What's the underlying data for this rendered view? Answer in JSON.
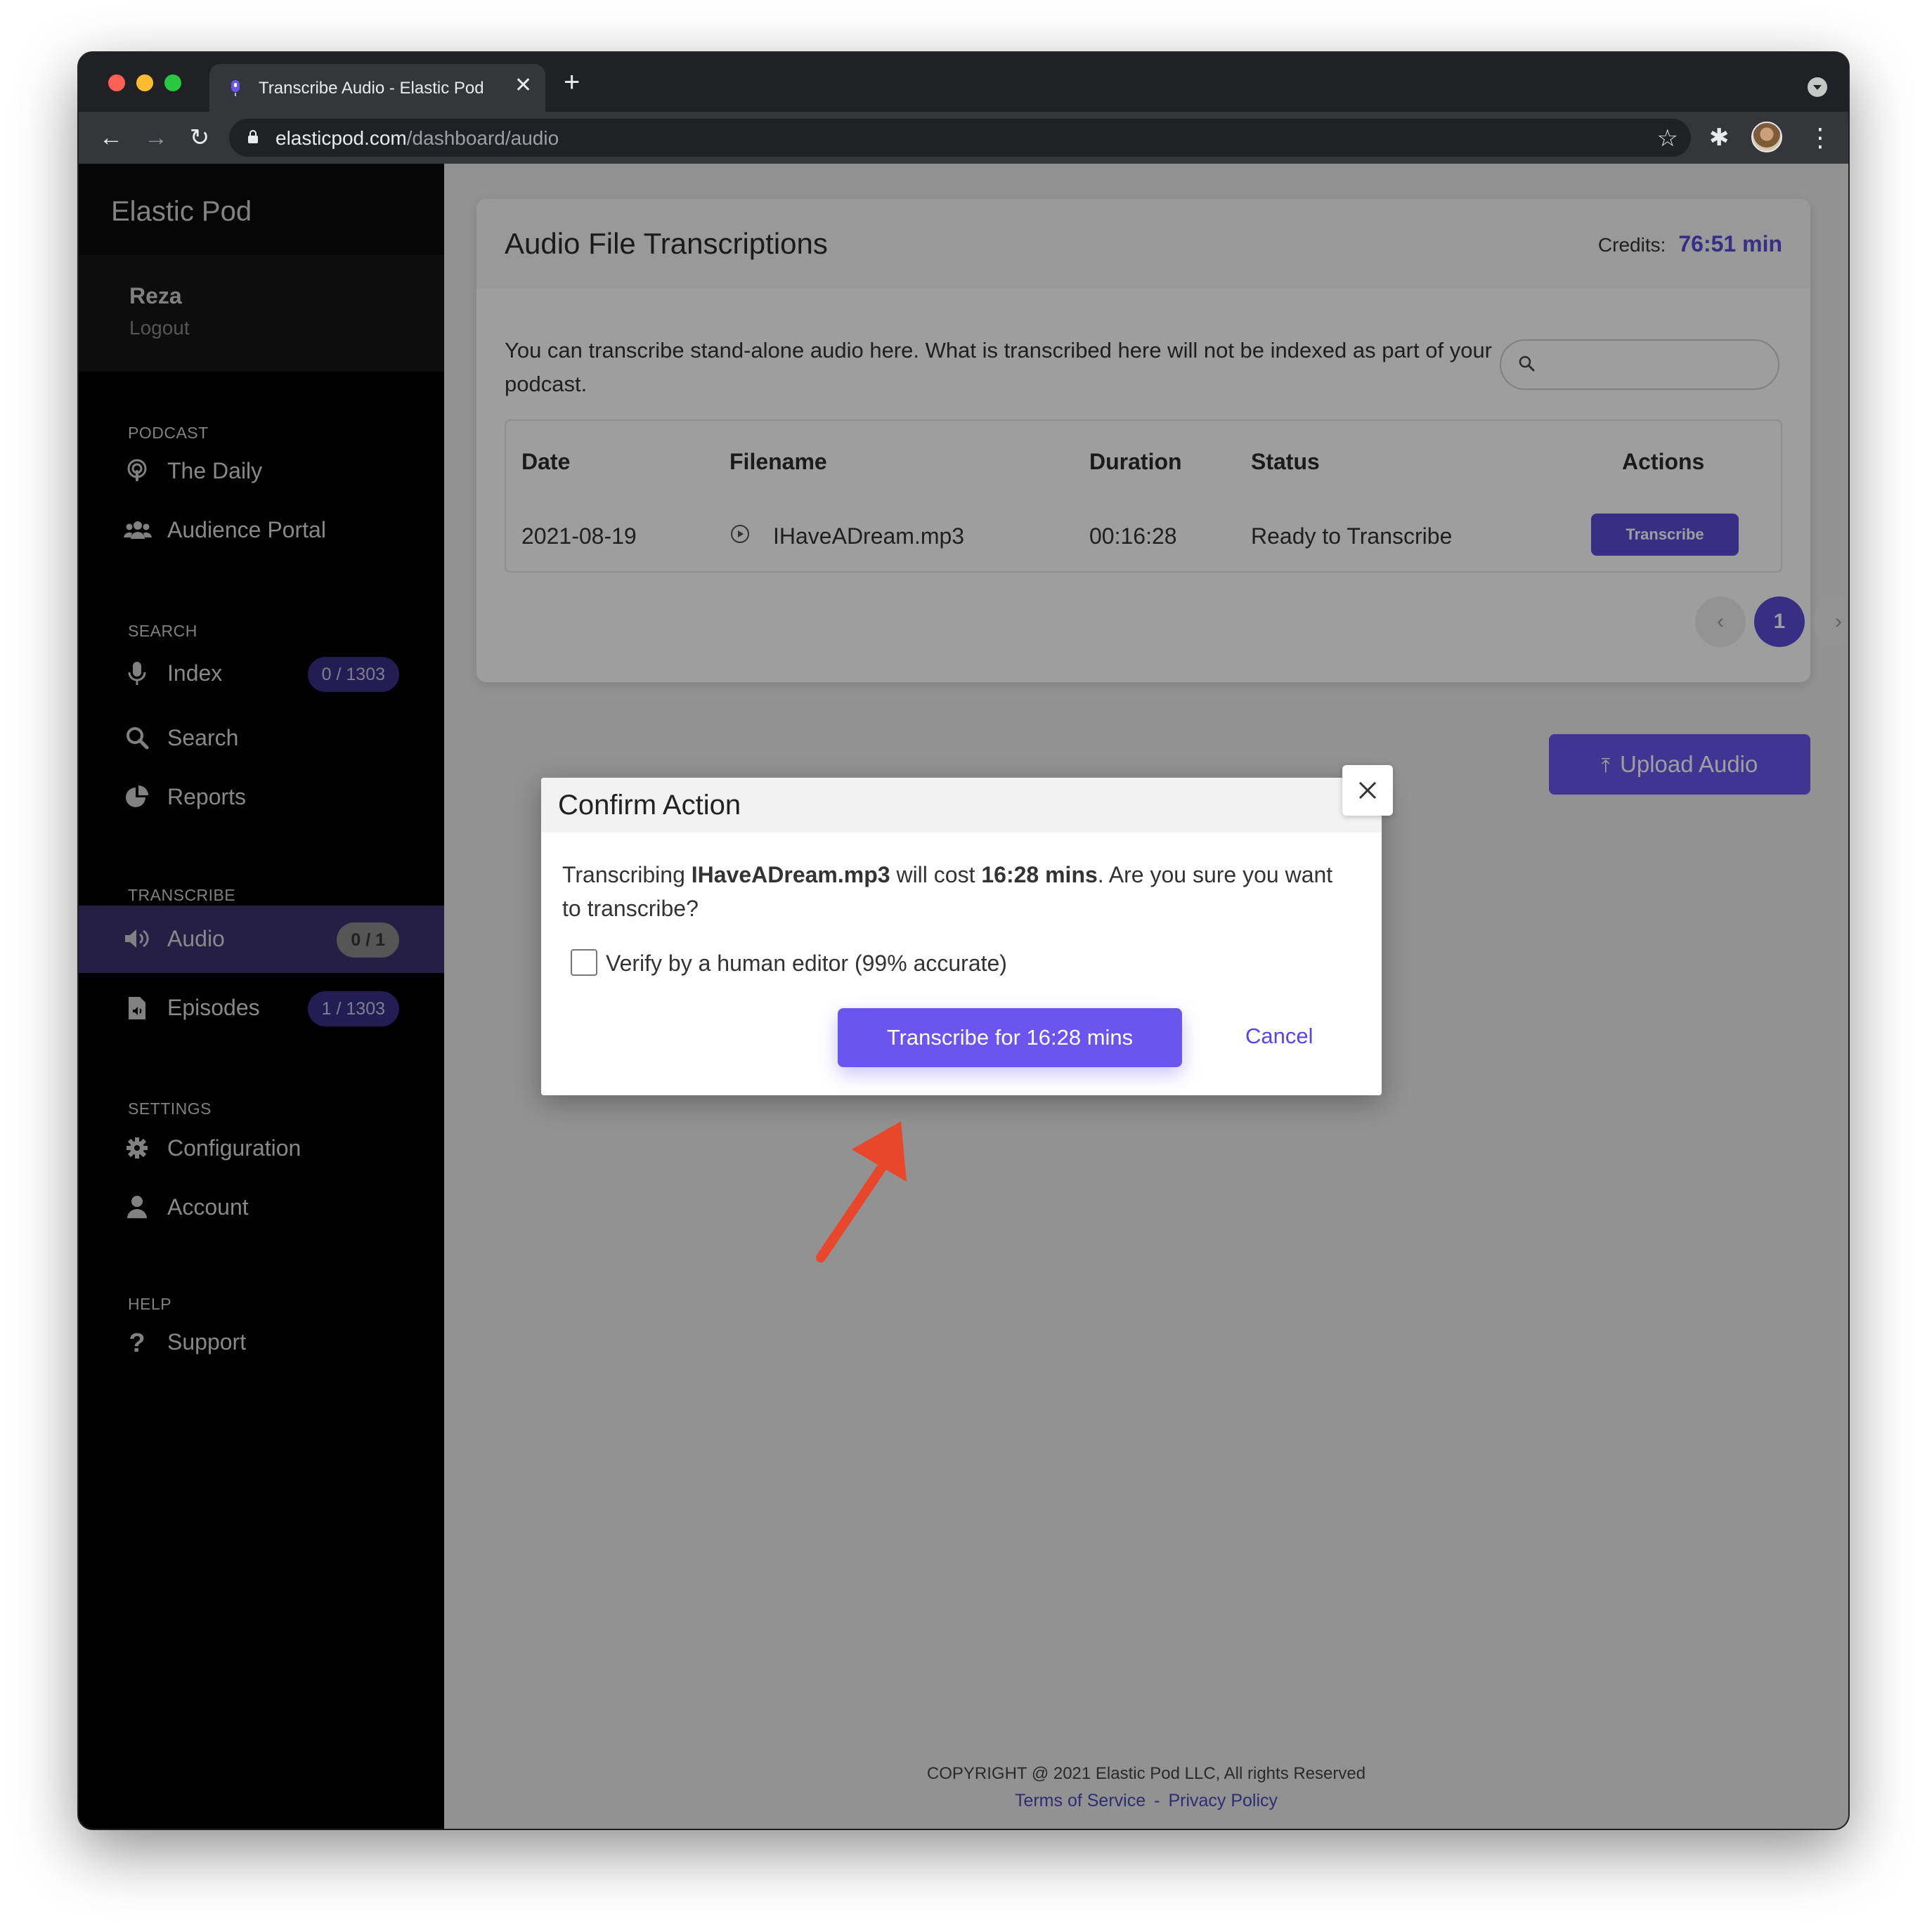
{
  "browser": {
    "tab_title": "Transcribe Audio - Elastic Pod",
    "url_host": "elasticpod.com",
    "url_path": "/dashboard/audio"
  },
  "sidebar": {
    "brand": "Elastic Pod",
    "user_name": "Reza",
    "logout": "Logout",
    "sections": {
      "podcast": "PODCAST",
      "search": "SEARCH",
      "transcribe": "TRANSCRIBE",
      "settings": "SETTINGS",
      "help": "HELP"
    },
    "items": {
      "the_daily": "The Daily",
      "audience_portal": "Audience Portal",
      "index": "Index",
      "index_badge": "0 / 1303",
      "search": "Search",
      "reports": "Reports",
      "audio": "Audio",
      "audio_badge": "0 / 1",
      "episodes": "Episodes",
      "episodes_badge": "1 / 1303",
      "configuration": "Configuration",
      "account": "Account",
      "support": "Support"
    }
  },
  "main": {
    "title": "Audio File Transcriptions",
    "credits_label": "Credits:",
    "credits_value": "76:51 min",
    "description": "You can transcribe stand-alone audio here. What is transcribed here will not be indexed as part of your podcast.",
    "search_placeholder": "",
    "table": {
      "headers": [
        "Date",
        "Filename",
        "Duration",
        "Status",
        "Actions"
      ],
      "rows": [
        {
          "date": "2021-08-19",
          "filename": "IHaveADream.mp3",
          "duration": "00:16:28",
          "status": "Ready to Transcribe",
          "action": "Transcribe"
        }
      ]
    },
    "pagination": {
      "prev": "‹",
      "current": "1",
      "next": "›"
    },
    "upload_button": "Upload Audio"
  },
  "footer": {
    "copyright": "COPYRIGHT @ 2021 Elastic Pod LLC, All rights Reserved",
    "terms": "Terms of Service",
    "separator": "-",
    "privacy": "Privacy Policy"
  },
  "modal": {
    "title": "Confirm Action",
    "msg_prefix": "Transcribing ",
    "msg_file": "IHaveADream.mp3",
    "msg_mid": " will cost ",
    "msg_cost": "16:28 mins",
    "msg_suffix": ". Are you sure you want to transcribe?",
    "checkbox_label": "Verify by a human editor (99% accurate)",
    "checkbox_checked": false,
    "confirm_button": "Transcribe for 16:28 mins",
    "cancel_button": "Cancel"
  },
  "colors": {
    "accent": "#6a55ee",
    "accent_dark": "#5b4bd5",
    "annotation_arrow": "#e8472b"
  }
}
